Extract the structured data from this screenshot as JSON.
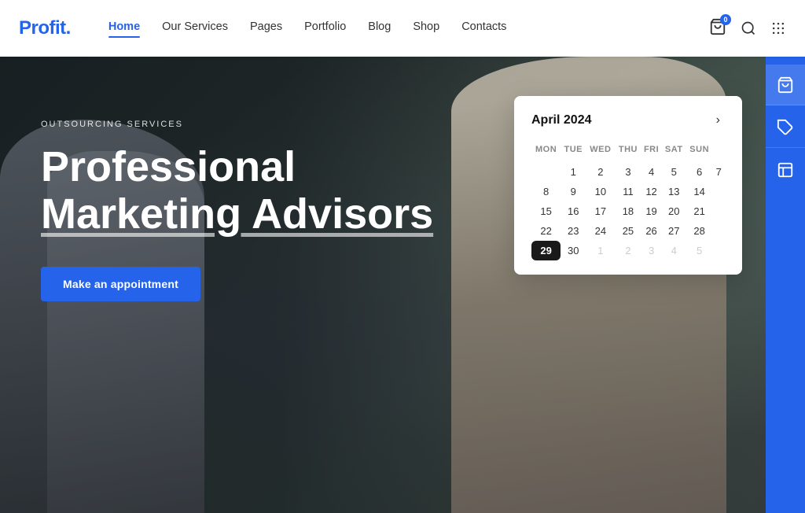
{
  "logo": {
    "text": "Profit",
    "dot": "."
  },
  "nav": {
    "items": [
      {
        "label": "Home",
        "active": true
      },
      {
        "label": "Our Services",
        "active": false
      },
      {
        "label": "Pages",
        "active": false
      },
      {
        "label": "Portfolio",
        "active": false
      },
      {
        "label": "Blog",
        "active": false
      },
      {
        "label": "Shop",
        "active": false
      },
      {
        "label": "Contacts",
        "active": false
      }
    ]
  },
  "cart": {
    "badge": "0"
  },
  "hero": {
    "tag": "Outsourcing Services",
    "title_line1": "Professional",
    "title_line2": "Marketing Advisors",
    "cta_label": "Make an appointment"
  },
  "calendar": {
    "month_year": "April 2024",
    "day_headers": [
      "MON",
      "TUE",
      "WED",
      "THU",
      "FRI",
      "SAT",
      "SUN"
    ],
    "weeks": [
      [
        {
          "day": "",
          "other": true
        },
        {
          "day": "1"
        },
        {
          "day": "2"
        },
        {
          "day": "3"
        },
        {
          "day": "4"
        },
        {
          "day": "5"
        },
        {
          "day": "6"
        },
        {
          "day": "7"
        }
      ],
      [
        {
          "day": "8"
        },
        {
          "day": "9"
        },
        {
          "day": "10"
        },
        {
          "day": "11"
        },
        {
          "day": "12"
        },
        {
          "day": "13"
        },
        {
          "day": "14"
        }
      ],
      [
        {
          "day": "15"
        },
        {
          "day": "16"
        },
        {
          "day": "17"
        },
        {
          "day": "18"
        },
        {
          "day": "19"
        },
        {
          "day": "20"
        },
        {
          "day": "21"
        }
      ],
      [
        {
          "day": "22"
        },
        {
          "day": "23"
        },
        {
          "day": "24"
        },
        {
          "day": "25"
        },
        {
          "day": "26"
        },
        {
          "day": "27"
        },
        {
          "day": "28"
        }
      ],
      [
        {
          "day": "29",
          "selected": true
        },
        {
          "day": "30"
        },
        {
          "day": "1",
          "other": true
        },
        {
          "day": "2",
          "other": true
        },
        {
          "day": "3",
          "other": true
        },
        {
          "day": "4",
          "other": true
        },
        {
          "day": "5",
          "other": true
        }
      ]
    ]
  },
  "sidebar_icons": [
    {
      "name": "cart-sidebar-icon",
      "label": "Cart",
      "active": true
    },
    {
      "name": "tag-sidebar-icon",
      "label": "Tag",
      "active": false
    },
    {
      "name": "layout-sidebar-icon",
      "label": "Layout",
      "active": false
    }
  ]
}
